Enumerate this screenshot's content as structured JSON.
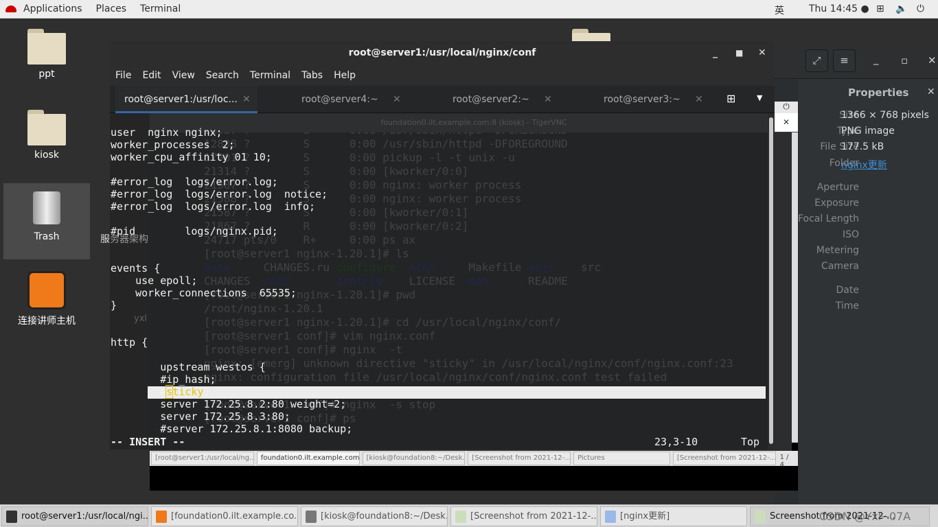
{
  "topbar": {
    "applications": "Applications",
    "places": "Places",
    "terminal": "Terminal",
    "input_method": "英",
    "clock": "Thu 14:45 ●"
  },
  "desktop": {
    "icons": [
      {
        "label": "ppt"
      },
      {
        "label": "kiosk"
      },
      {
        "label": "Trash"
      },
      {
        "label": "连接讲师主机"
      }
    ],
    "hidden_labels": [
      "服务器架构",
      "yxl"
    ]
  },
  "viewer": {
    "properties_title": "Properties",
    "fields": [
      {
        "label": "Size",
        "value": "1366 × 768 pixels"
      },
      {
        "label": "Type",
        "value": "PNG image"
      },
      {
        "label": "File Size",
        "value": "177.5 kB"
      },
      {
        "label": "Folder",
        "value": "nginx更新"
      }
    ],
    "empty_fields": [
      "Aperture",
      "Exposure",
      "Focal Length",
      "ISO",
      "Metering",
      "Camera",
      "Date",
      "Time"
    ],
    "link_color": "#3d8fd6"
  },
  "vnc": {
    "title": "foundation0.ilt.example.com:8 (kiosk) - TigerVNC",
    "lines": [
      "12837 ?        S      0:00 /usr/sbin/httpd -DFOREGROUND",
      "12838 ?        S      0:00 /usr/sbin/httpd -DFOREGROUND",
      "17901 ?        S      0:00 pickup -l -t unix -u",
      "21314 ?        S      0:00 [kworker/0:0]",
      "21587 ?        S      0:00 nginx: worker process",
      "21588 ?        S      0:00 nginx: worker process",
      "21587 ?        S      0:00 [kworker/0:1]",
      "21867 ?        R      0:00 [kworker/0:2]",
      "24717 pts/0    R+     0:00 ps ax",
      "[root@server1 nginx-1.20.1]# ls"
    ],
    "ls1": [
      "auto",
      "CHANGES.ru",
      "configure",
      "html",
      "Makefile",
      "objs",
      "src"
    ],
    "ls2": [
      "CHANGES",
      "conf",
      "contrib",
      "LICENSE",
      "man",
      "README"
    ],
    "lines2": [
      "[root@server1 nginx-1.20.1]# pwd",
      "/root/nginx-1.20.1",
      "[root@server1 nginx-1.20.1]# cd /usr/local/nginx/conf/",
      "[root@server1 conf]# vim nginx.conf",
      "[root@server1 conf]# nginx  -t",
      "nginx: [emerg] unknown directive \"sticky\" in /usr/local/nginx/conf/nginx.conf:23",
      "nginx: configuration file /usr/local/nginx/conf/nginx.conf test failed",
      "",
      "[root@server1 conf]# nginx  -s stop",
      "[root@server1 conf]# ps"
    ],
    "taskbar": [
      "[root@server1:/usr/local/ng...",
      "foundation0.ilt.example.com...",
      "[kiosk@foundation8:~/Desk...",
      "[Screenshot from 2021-12-...",
      "Pictures",
      "[Screenshot from 2021-12-..."
    ],
    "pager": "1 / 4"
  },
  "terminal": {
    "title": "root@server1:/usr/local/nginx/conf",
    "menu": [
      "File",
      "Edit",
      "View",
      "Search",
      "Terminal",
      "Tabs",
      "Help"
    ],
    "tabs": [
      {
        "label": "root@server1:/usr/loc...",
        "active": true
      },
      {
        "label": "root@server4:~"
      },
      {
        "label": "root@server2:~"
      },
      {
        "label": "root@server3:~"
      }
    ],
    "lines": [
      "user  nginx nginx;",
      "worker_processes  2;",
      "worker_cpu_affinity 01 10;",
      "",
      "#error_log  logs/error.log;",
      "#error_log  logs/error.log  notice;",
      "#error_log  logs/error.log  info;",
      "",
      "#pid        logs/nginx.pid;",
      "",
      "",
      "events {",
      "    use epoll;",
      "    worker_connections  65535;",
      "}",
      "",
      "",
      "http {",
      "",
      "        upstream westos {",
      "        #ip_hash;"
    ],
    "cursor_line": {
      "prefix": "        #",
      "cursor": "s",
      "word": "ticky",
      "suffix": ";"
    },
    "lines_after": [
      "        server 172.25.8.2:80 weight=2;",
      "        server 172.25.8.3:80;",
      "        #server 172.25.8.1:8080 backup;"
    ],
    "mode": "-- INSERT --",
    "position": "23,3-10",
    "scroll": "Top"
  },
  "taskbar": [
    {
      "label": "root@server1:/usr/local/ngi...",
      "active": true
    },
    {
      "label": "[foundation0.ilt.example.co..."
    },
    {
      "label": "[kiosk@foundation8:~/Desk..."
    },
    {
      "label": "[Screenshot from 2021-12-..."
    },
    {
      "label": "[nginx更新]"
    },
    {
      "label": "Screenshot from 2021-12-..."
    }
  ],
  "watermark": "CSDN @Yxl--07A"
}
